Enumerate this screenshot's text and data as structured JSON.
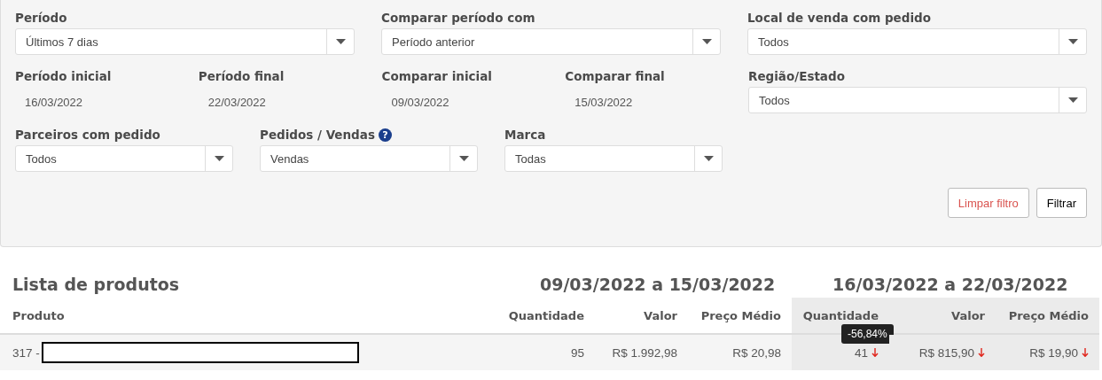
{
  "filters": [
    {
      "kind": "select",
      "label": "Período",
      "value": "Últimos 7 dias"
    },
    {
      "kind": "select",
      "label": "Comparar período com",
      "value": "Período anterior"
    },
    {
      "kind": "select",
      "label": "Local de venda com pedido",
      "value": "Todos"
    },
    {
      "kind": "date",
      "label": "Período inicial",
      "value": "16/03/2022"
    },
    {
      "kind": "date",
      "label": "Período final",
      "value": "22/03/2022"
    },
    {
      "kind": "date",
      "label": "Comparar inicial",
      "value": "09/03/2022"
    },
    {
      "kind": "date",
      "label": "Comparar final",
      "value": "15/03/2022"
    },
    {
      "kind": "select",
      "label": "Região/Estado",
      "value": "Todos"
    },
    {
      "kind": "select",
      "label": "Parceiros com pedido",
      "value": "Todos"
    },
    {
      "kind": "select",
      "label": "Pedidos / Vendas",
      "value": "Vendas",
      "help": "?"
    },
    {
      "kind": "select",
      "label": "Marca",
      "value": "Todas"
    }
  ],
  "buttons": [
    {
      "label": "Limpar filtro",
      "kind": "clear"
    },
    {
      "label": "Filtrar",
      "kind": "primary"
    }
  ],
  "products": {
    "title": "Lista de produtos",
    "periods": [
      "09/03/2022 a 15/03/2022",
      "16/03/2022 a 22/03/2022"
    ],
    "columns": [
      "Produto",
      "Quantidade",
      "Valor",
      "Preço Médio",
      "Quantidade",
      "Valor",
      "Preço Médio"
    ],
    "rows": [
      {
        "cells": [
          {
            "kind": "product",
            "text": "317 -"
          },
          {
            "kind": "number",
            "text": "95",
            "decreased": false
          },
          {
            "kind": "number",
            "text": "R$ 1.992,98",
            "decreased": false
          },
          {
            "kind": "number",
            "text": "R$ 20,98",
            "decreased": false
          },
          {
            "kind": "number",
            "text": "41",
            "decreased": true,
            "tooltip": "-56,84%"
          },
          {
            "kind": "number",
            "text": "R$ 815,90",
            "decreased": true
          },
          {
            "kind": "number",
            "text": "R$ 19,90",
            "decreased": true
          }
        ]
      }
    ]
  }
}
